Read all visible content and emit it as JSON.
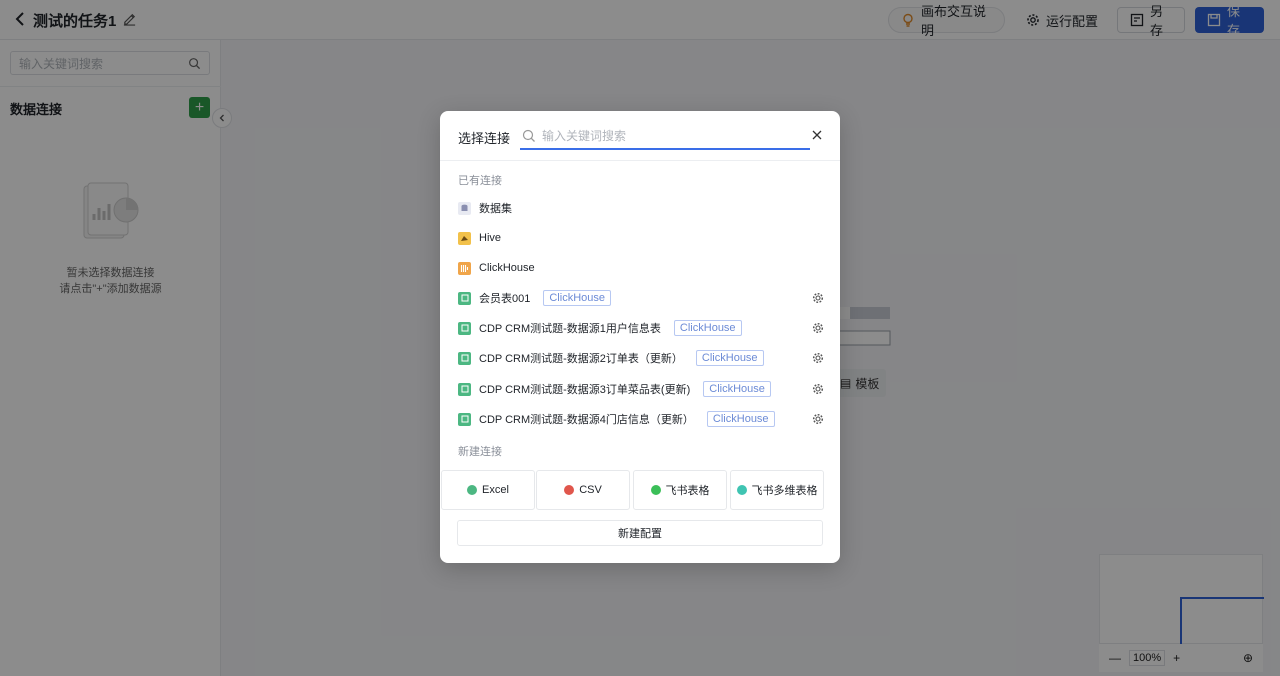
{
  "header": {
    "title": "测试的任务1",
    "canvas_help": "画布交互说明",
    "run_config": "运行配置",
    "save_as": "另存",
    "save": "保存"
  },
  "left_panel": {
    "search_placeholder": "输入关键词搜索",
    "section_title": "数据连接",
    "add_symbol": "+",
    "empty_line1": "暂未选择数据连接",
    "empty_line2": "请点击\"+\"添加数据源"
  },
  "canvas": {
    "template_label": "模板",
    "zoom": "100%"
  },
  "modal": {
    "title": "选择连接",
    "search_placeholder": "输入关键词搜索",
    "existing_title": "已有连接",
    "existing": [
      {
        "name": "数据集",
        "icon": "dataset-icon"
      },
      {
        "name": "Hive",
        "icon": "hive-icon"
      },
      {
        "name": "ClickHouse",
        "icon": "clickhouse-icon"
      },
      {
        "name": "会员表001",
        "tag": "ClickHouse",
        "icon": "sheet-icon"
      },
      {
        "name": "CDP CRM测试题-数据源1用户信息表",
        "tag": "ClickHouse",
        "icon": "sheet-icon"
      },
      {
        "name": "CDP CRM测试题-数据源2订单表（更新）",
        "tag": "ClickHouse",
        "icon": "sheet-icon"
      },
      {
        "name": "CDP CRM测试题-数据源3订单菜品表(更新)",
        "tag": "ClickHouse",
        "icon": "sheet-icon"
      },
      {
        "name": "CDP CRM测试题-数据源4门店信息（更新）",
        "tag": "ClickHouse",
        "icon": "sheet-icon"
      }
    ],
    "new_title": "新建连接",
    "new_types": [
      {
        "label": "Excel",
        "color": "#4cb782"
      },
      {
        "label": "CSV",
        "color": "#e0564c"
      },
      {
        "label": "飞书表格",
        "color": "#3bbf58"
      },
      {
        "label": "飞书多维表格",
        "color": "#3fc4b2"
      }
    ],
    "new_config": "新建配置"
  }
}
